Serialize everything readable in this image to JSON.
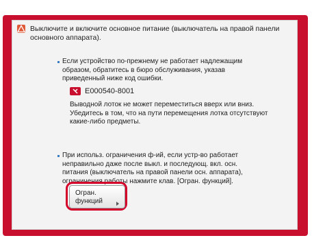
{
  "warning": {
    "icon": "warning-triangle-icon",
    "text": "Выключите и включите основное питание (выключатель на правой панели основного аппарата)."
  },
  "section1": {
    "text": "Если устройство по-прежнему не работает надлежащим образом, обратитесь в бюро обслуживания, указав приведенный ниже код ошибки.",
    "error_icon": "service-tool-icon",
    "error_code": "E000540-8001",
    "detail": "Выводной лоток не может переместиться вверх или вниз. Убедитесь в том, что на пути перемещения лотка отсутствуют какие-либо предметы."
  },
  "section2": {
    "text": "При использ. ограничения ф-ий, если устр-во работает неправильно даже после выкл. и последующ. вкл. осн. питания (выключатель на правой панели осн. аппарата), ограничения работы нажмите клав. [Огран. функций]."
  },
  "button": {
    "label": "Огран. функций",
    "icon": "chevron-right-icon"
  },
  "colors": {
    "panel": "#c8102e",
    "highlight": "#d4002a",
    "bullet": "#3a7abf"
  }
}
